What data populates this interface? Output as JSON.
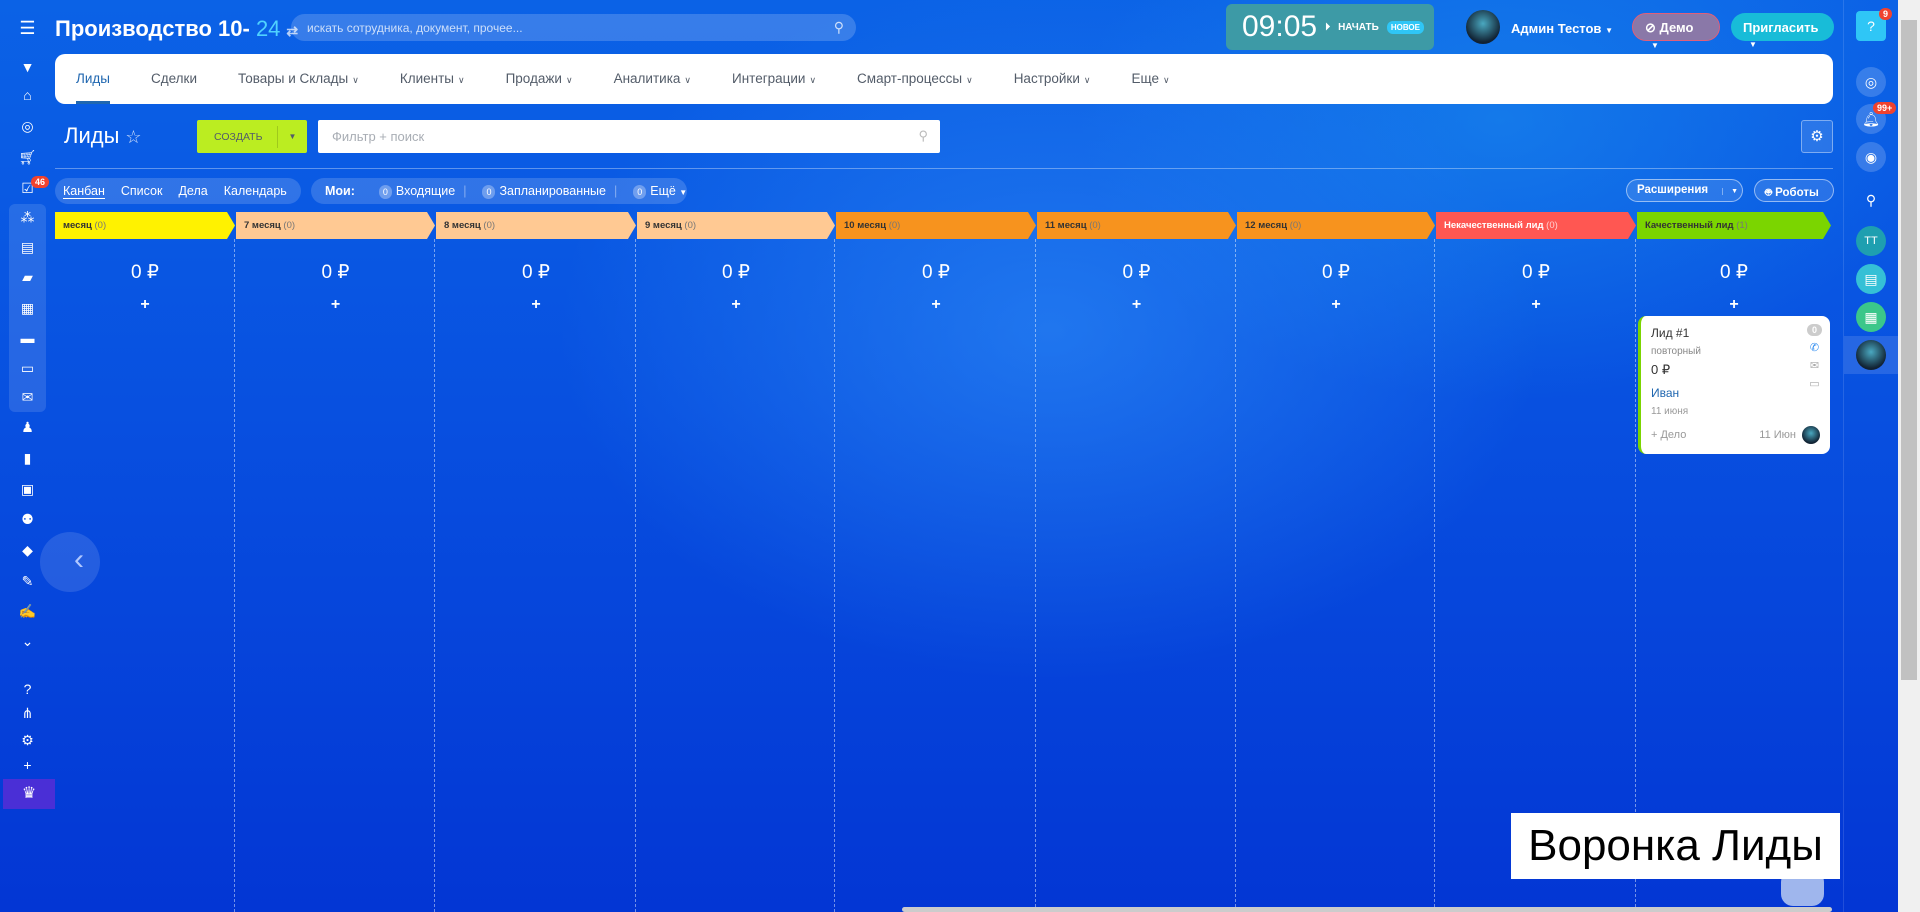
{
  "header": {
    "portal_name": "Производство 10-",
    "portal_suffix": "24",
    "search_placeholder": "искать сотрудника, документ, прочее...",
    "clock": "09:05",
    "start_label": "НАЧАТЬ",
    "new_badge": "НОВОЕ",
    "user_name": "Админ Тестов",
    "demo_label": "Демо",
    "invite_label": "Пригласить"
  },
  "left_sidebar": {
    "tasks_badge": "46"
  },
  "right_sidebar": {
    "help_badge": "9",
    "notifications_badge": "99+",
    "user_initials": "ТТ"
  },
  "nav": {
    "tabs": [
      {
        "label": "Лиды",
        "active": true
      },
      {
        "label": "Сделки"
      },
      {
        "label": "Товары и Склады",
        "dropdown": true
      },
      {
        "label": "Клиенты",
        "dropdown": true
      },
      {
        "label": "Продажи",
        "dropdown": true
      },
      {
        "label": "Аналитика",
        "dropdown": true
      },
      {
        "label": "Интеграции",
        "dropdown": true
      },
      {
        "label": "Смарт-процессы",
        "dropdown": true
      },
      {
        "label": "Настройки",
        "dropdown": true
      },
      {
        "label": "Еще",
        "dropdown": true
      }
    ]
  },
  "page": {
    "title": "Лиды",
    "create_label": "СОЗДАТЬ",
    "filter_placeholder": "Фильтр + поиск"
  },
  "views": {
    "items": [
      "Канбан",
      "Список",
      "Дела",
      "Календарь"
    ],
    "active": "Канбан"
  },
  "my": {
    "label": "Мои:",
    "incoming_count": "0",
    "incoming": "Входящие",
    "planned_count": "0",
    "planned": "Запланированные",
    "more_count": "0",
    "more": "Ещё"
  },
  "toolbar": {
    "extensions": "Расширения",
    "robots": "Роботы"
  },
  "columns": [
    {
      "title": "месяц",
      "count": "(0)",
      "sum": "0 ₽",
      "color": "#fff200"
    },
    {
      "title": "7 месяц",
      "count": "(0)",
      "sum": "0 ₽",
      "color": "#ffc993"
    },
    {
      "title": "8 месяц",
      "count": "(0)",
      "sum": "0 ₽",
      "color": "#ffc993"
    },
    {
      "title": "9 месяц",
      "count": "(0)",
      "sum": "0 ₽",
      "color": "#ffc993"
    },
    {
      "title": "10 месяц",
      "count": "(0)",
      "sum": "0 ₽",
      "color": "#f7931e"
    },
    {
      "title": "11 месяц",
      "count": "(0)",
      "sum": "0 ₽",
      "color": "#f7931e"
    },
    {
      "title": "12 месяц",
      "count": "(0)",
      "sum": "0 ₽",
      "color": "#f7931e"
    },
    {
      "title": "Некачественный лид",
      "count": "(0)",
      "sum": "0 ₽",
      "color": "#ff5752",
      "text": "#ffffff"
    },
    {
      "title": "Качественный лид",
      "count": "(1)",
      "sum": "0 ₽",
      "color": "#7bd500"
    }
  ],
  "card": {
    "title": "Лид #1",
    "status": "повторный",
    "amount": "0 ₽",
    "contact": "Иван",
    "date": "11 июня",
    "add_activity": "+ Дело",
    "footer_date": "11 Июн",
    "activity_count": "0"
  },
  "overlay_label": "Воронка Лиды"
}
